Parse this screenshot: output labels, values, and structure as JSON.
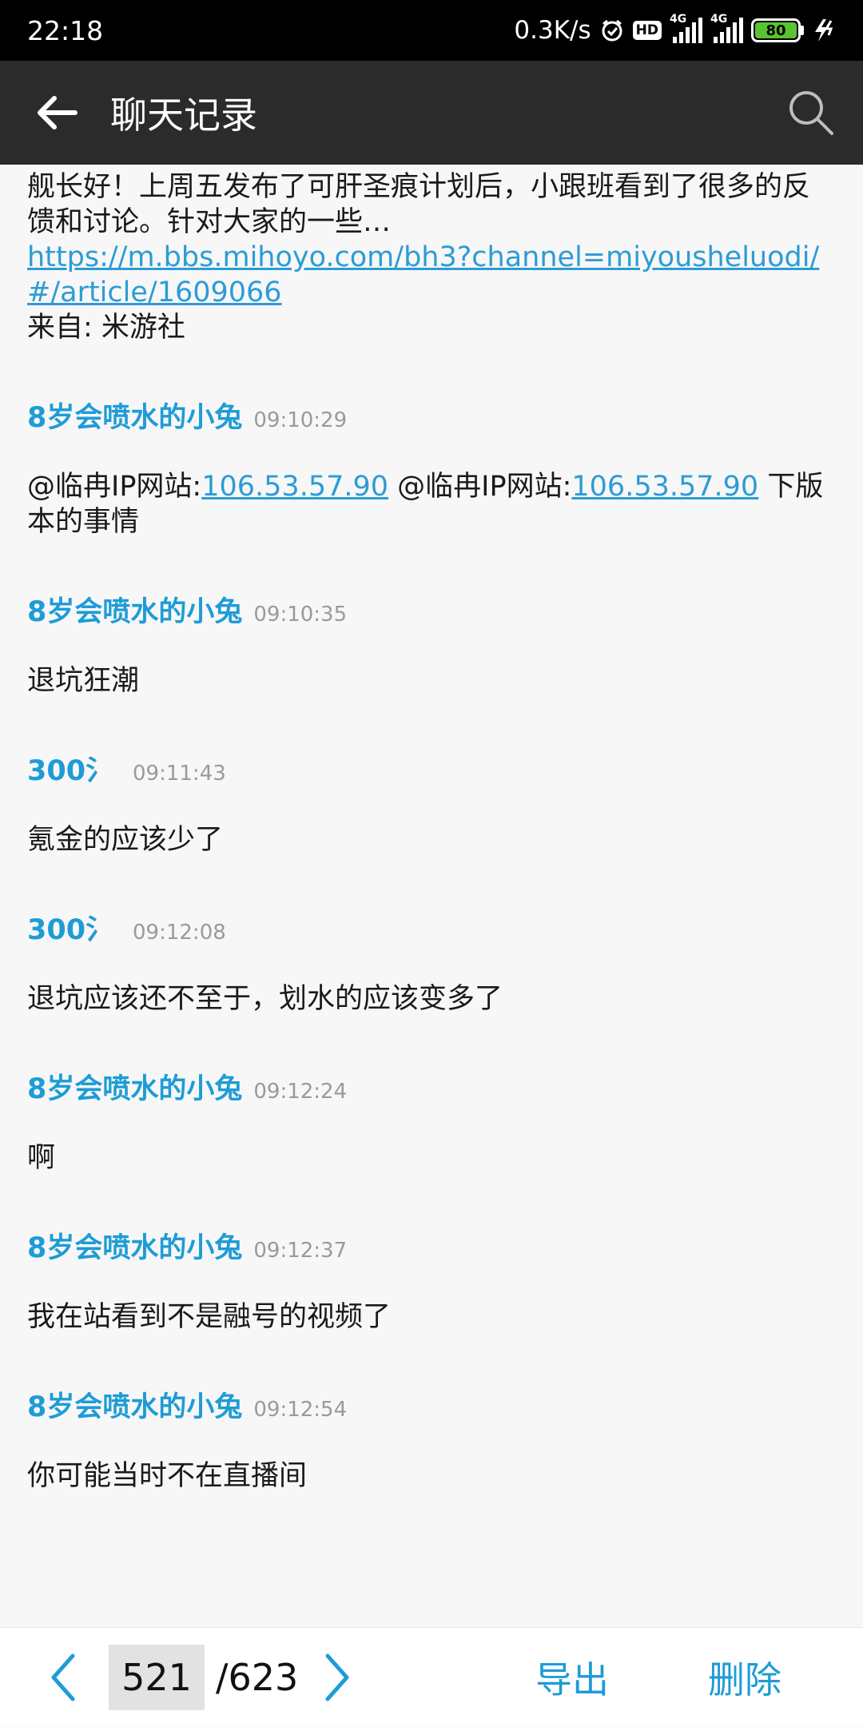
{
  "status_bar": {
    "time": "22:18",
    "net_speed": "0.3K/s",
    "hd_label": "HD",
    "network_1": "4G",
    "network_2": "4G",
    "battery_level": "80"
  },
  "header": {
    "title": "聊天记录"
  },
  "first_message": {
    "text": "舰长好！上周五发布了可肝圣痕计划后，小跟班看到了很多的反馈和讨论。针对大家的一些…",
    "link": "https://m.bbs.mihoyo.com/bh3?channel=miyousheluodi/#/article/1609066",
    "source": "来自: 米游社"
  },
  "messages": [
    {
      "sender": "8岁会喷水的小兔",
      "time": "09:10:29",
      "prefix_1": "@临冉IP网站:",
      "link_1": "106.53.57.90",
      "prefix_2": " @临冉IP网站:",
      "link_2": "106.53.57.90",
      "suffix": " 下版本的事情"
    },
    {
      "sender": "8岁会喷水的小兔",
      "time": "09:10:35",
      "text": "退坑狂潮"
    },
    {
      "sender": "300氵",
      "time": "09:11:43",
      "text": "氪金的应该少了"
    },
    {
      "sender": "300氵",
      "time": "09:12:08",
      "text": "退坑应该还不至于，划水的应该变多了"
    },
    {
      "sender": "8岁会喷水的小兔",
      "time": "09:12:24",
      "text": "啊"
    },
    {
      "sender": "8岁会喷水的小兔",
      "time": "09:12:37",
      "text": "我在站看到不是融号的视频了"
    },
    {
      "sender": "8岁会喷水的小兔",
      "time": "09:12:54",
      "text": "你可能当时不在直播间"
    }
  ],
  "footer": {
    "current_page": "521",
    "total_pages": "/623",
    "export_label": "导出",
    "delete_label": "删除"
  },
  "colors": {
    "accent": "#1e9cd6",
    "header_bg": "#2b2b2b",
    "battery": "#58c431"
  },
  "icons": [
    "back-arrow-icon",
    "search-icon",
    "chevron-left-icon",
    "chevron-right-icon",
    "alarm-icon",
    "charging-icon"
  ]
}
